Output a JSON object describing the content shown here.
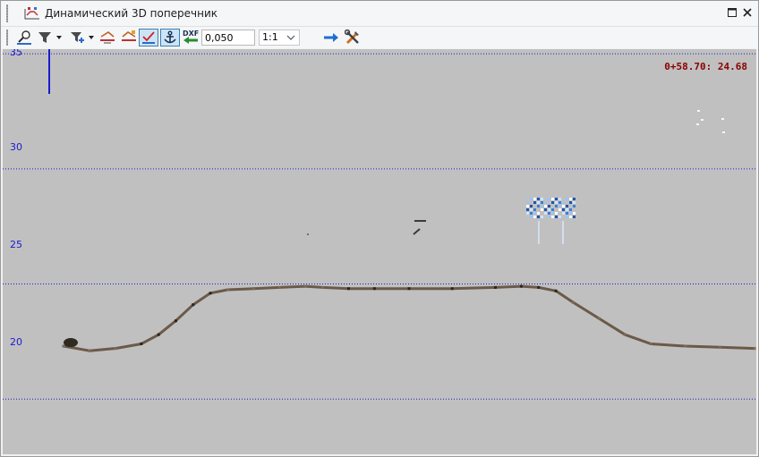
{
  "window": {
    "title": "Динамический 3D поперечник"
  },
  "toolbar": {
    "step_value": "0,050",
    "scale_value": "1:1",
    "dxf_label": "DXF",
    "buttons": [
      "zoom-extents",
      "filter",
      "filter-add",
      "align-left",
      "align-right",
      "show-checked",
      "anchor",
      "export-dxf",
      "forward",
      "settings"
    ]
  },
  "plot": {
    "readout": "0+58.70: 24.68",
    "y_ticks": [
      "35",
      "30",
      "25",
      "20"
    ],
    "colors": {
      "background": "#c0c0c0",
      "gridline": "#1a1ad0",
      "readout": "#8b0000"
    }
  },
  "chart_data": {
    "type": "scatter",
    "title": "",
    "xlabel": "",
    "ylabel": "",
    "ylim": [
      17.6,
      35.2
    ],
    "yticks": [
      35,
      30,
      25,
      20
    ],
    "grid": true,
    "series": [
      {
        "profile": [
          [
            0,
            22.3
          ],
          [
            3,
            22.1
          ],
          [
            6,
            22.2
          ],
          [
            9,
            22.4
          ],
          [
            11,
            22.8
          ],
          [
            13,
            23.4
          ],
          [
            15,
            24.1
          ],
          [
            17,
            24.6
          ],
          [
            19,
            24.75
          ],
          [
            22,
            24.8
          ],
          [
            25,
            24.85
          ],
          [
            28,
            24.9
          ],
          [
            30,
            24.85
          ],
          [
            33,
            24.8
          ],
          [
            36,
            24.8
          ],
          [
            40,
            24.8
          ],
          [
            45,
            24.8
          ],
          [
            50,
            24.85
          ],
          [
            53,
            24.9
          ],
          [
            55,
            24.85
          ],
          [
            57,
            24.7
          ],
          [
            59,
            24.2
          ],
          [
            62,
            23.5
          ],
          [
            65,
            22.8
          ],
          [
            68,
            22.4
          ],
          [
            72,
            22.3
          ],
          [
            76,
            22.25
          ],
          [
            80,
            22.2
          ]
        ]
      }
    ]
  }
}
